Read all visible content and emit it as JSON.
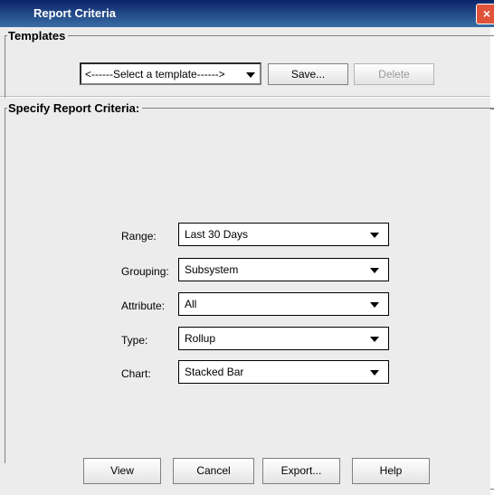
{
  "window": {
    "title": "Report Criteria",
    "close_glyph": "×"
  },
  "templates": {
    "group_title": "Templates",
    "select_value": "<------Select a template------>",
    "save_label": "Save...",
    "delete_label": "Delete"
  },
  "criteria": {
    "group_title": "Specify Report Criteria:",
    "range": {
      "label": "Range:",
      "value": "Last 30 Days"
    },
    "grouping": {
      "label": "Grouping:",
      "value": "Subsystem"
    },
    "attribute": {
      "label": "Attribute:",
      "value": "All"
    },
    "type": {
      "label": "Type:",
      "value": "Rollup"
    },
    "chart": {
      "label": "Chart:",
      "value": "Stacked Bar"
    }
  },
  "buttons": {
    "view": "View",
    "cancel": "Cancel",
    "export": "Export...",
    "help": "Help"
  },
  "colors": {
    "title_bar_start": "#0a246a",
    "title_bar_end": "#3a6ea5",
    "close_button": "#e0533a",
    "panel_bg": "#ececec"
  },
  "icons": {
    "close": "close-icon",
    "dropdown": "chevron-down-icon"
  }
}
